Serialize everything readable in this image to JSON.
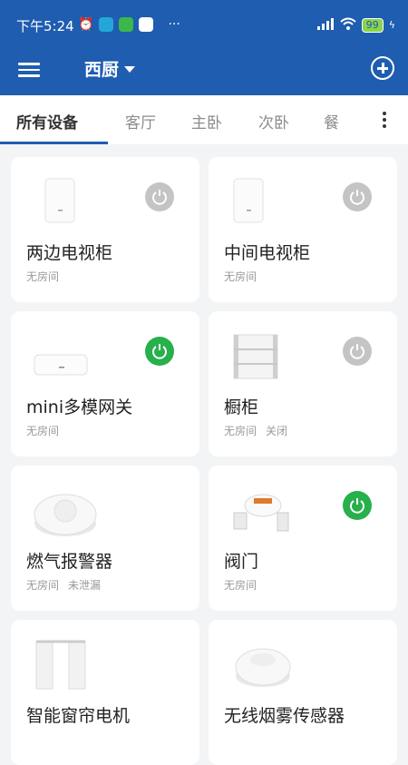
{
  "status_bar": {
    "time": "下午5:24",
    "battery": "99"
  },
  "app_bar": {
    "home_name": "西厨"
  },
  "tabs": [
    "所有设备",
    "客厅",
    "主卧",
    "次卧",
    "餐"
  ],
  "devices": [
    {
      "name": "两边电视柜",
      "room": "无房间",
      "status": "",
      "power": "off",
      "icon": "panel-device-icon"
    },
    {
      "name": "中间电视柜",
      "room": "无房间",
      "status": "",
      "power": "off",
      "icon": "panel-device-icon"
    },
    {
      "name": "mini多模网关",
      "room": "无房间",
      "status": "",
      "power": "on",
      "icon": "gateway-icon"
    },
    {
      "name": "橱柜",
      "room": "无房间",
      "status": "关闭",
      "power": "off",
      "icon": "cabinet-icon"
    },
    {
      "name": "燃气报警器",
      "room": "无房间",
      "status": "未泄漏",
      "power": "",
      "icon": "gas-alarm-icon"
    },
    {
      "name": "阀门",
      "room": "无房间",
      "status": "",
      "power": "on",
      "icon": "valve-icon"
    },
    {
      "name": "智能窗帘电机",
      "room": "",
      "status": "",
      "power": "",
      "icon": "curtain-icon"
    },
    {
      "name": "无线烟雾传感器",
      "room": "",
      "status": "",
      "power": "",
      "icon": "smoke-sensor-icon"
    }
  ],
  "colors": {
    "primary": "#1e5db0",
    "power_on": "#27b04b",
    "power_off": "#c4c4c4"
  }
}
